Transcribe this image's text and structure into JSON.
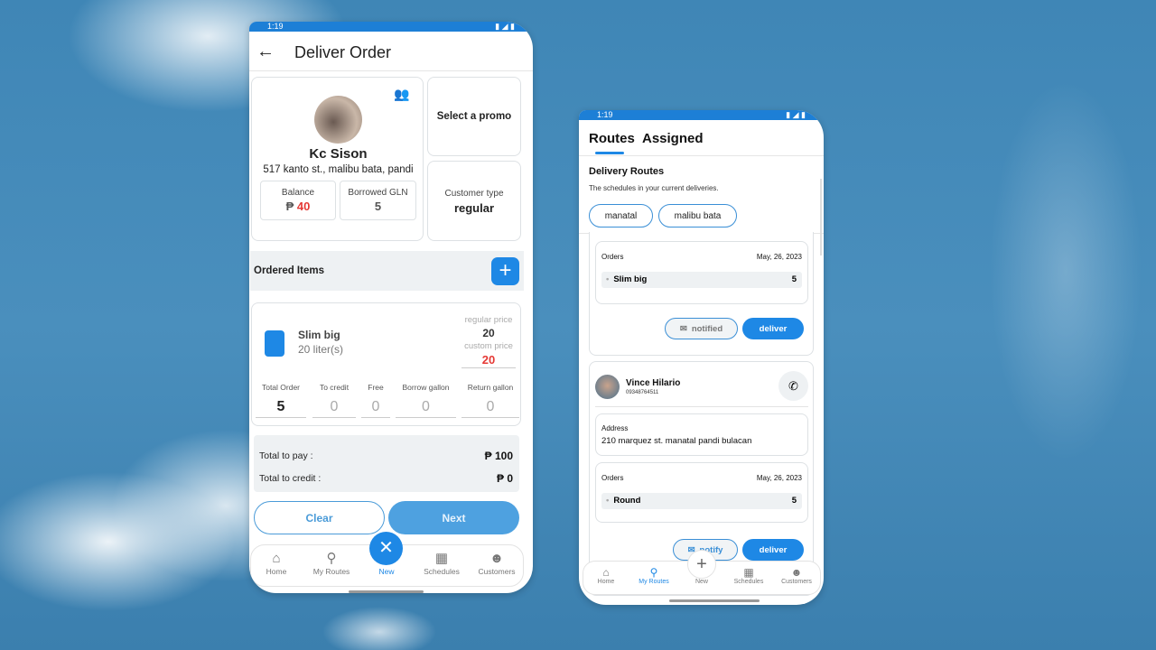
{
  "left": {
    "status_time": "1:19",
    "title": "Deliver Order",
    "customer": {
      "name": "Kc Sison",
      "address": "517 kanto st., malibu bata, pandi",
      "balance_label": "Balance",
      "balance_currency": "₱",
      "balance_value": "40",
      "borrowed_label": "Borrowed GLN",
      "borrowed_value": "5"
    },
    "promo_label": "Select a promo",
    "customer_type_label": "Customer type",
    "customer_type_value": "regular",
    "ordered_items_label": "Ordered Items",
    "item": {
      "name": "Slim big",
      "size": "20 liter(s)",
      "regular_price_label": "regular price",
      "regular_price": "20",
      "custom_price_label": "custom price",
      "custom_price": "20",
      "fields": [
        {
          "label": "Total Order",
          "value": "5"
        },
        {
          "label": "To credit",
          "value": "0"
        },
        {
          "label": "Free",
          "value": "0"
        },
        {
          "label": "Borrow gallon",
          "value": "0"
        },
        {
          "label": "Return gallon",
          "value": "0"
        }
      ]
    },
    "totals": {
      "pay_label": "Total to pay :",
      "pay_value": "₱ 100",
      "credit_label": "Total to credit :",
      "credit_value": "₱ 0"
    },
    "clear_label": "Clear",
    "next_label": "Next",
    "nav": [
      "Home",
      "My Routes",
      "New",
      "Schedules",
      "Customers"
    ]
  },
  "right": {
    "status_time": "1:19",
    "tabs": [
      "Routes",
      "Assigned"
    ],
    "section_title": "Delivery Routes",
    "section_sub": "The schedules in your current deliveries.",
    "chips": [
      "manatal",
      "malibu bata"
    ],
    "card1": {
      "orders_label": "Orders",
      "date": "May, 26, 2023",
      "item": "Slim big",
      "qty": "5",
      "notified_label": "notified",
      "deliver_label": "deliver"
    },
    "card2": {
      "name": "Vince Hilario",
      "phone": "09348764511",
      "address_label": "Address",
      "address": "210 marquez st. manatal pandi bulacan",
      "orders_label": "Orders",
      "date": "May, 26, 2023",
      "item": "Round",
      "qty": "5",
      "notify_label": "notify",
      "deliver_label": "deliver"
    },
    "nav": [
      "Home",
      "My Routes",
      "New",
      "Schedules",
      "Customers"
    ]
  },
  "colors": {
    "accent": "#1e88e5",
    "danger": "#e53935",
    "panel": "#eef1f3"
  }
}
